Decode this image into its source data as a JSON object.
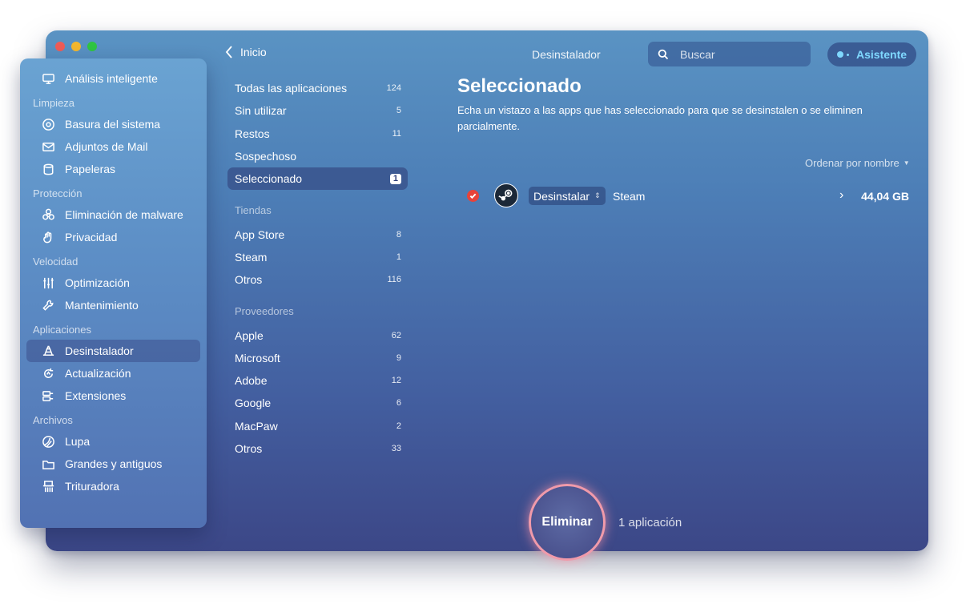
{
  "window": {
    "title": "Desinstalador",
    "back_label": "Inicio",
    "search_placeholder": "Buscar",
    "assistant_label": "Asistente"
  },
  "sidebar": {
    "top": {
      "label": "Análisis inteligente",
      "icon": "monitor-icon"
    },
    "sections": [
      {
        "title": "Limpieza",
        "items": [
          {
            "label": "Basura del sistema",
            "icon": "disc-icon"
          },
          {
            "label": "Adjuntos de Mail",
            "icon": "envelope-icon"
          },
          {
            "label": "Papeleras",
            "icon": "trash-icon"
          }
        ]
      },
      {
        "title": "Protección",
        "items": [
          {
            "label": "Eliminación de malware",
            "icon": "biohazard-icon"
          },
          {
            "label": "Privacidad",
            "icon": "hand-icon"
          }
        ]
      },
      {
        "title": "Velocidad",
        "items": [
          {
            "label": "Optimización",
            "icon": "sliders-icon"
          },
          {
            "label": "Mantenimiento",
            "icon": "wrench-icon"
          }
        ]
      },
      {
        "title": "Aplicaciones",
        "items": [
          {
            "label": "Desinstalador",
            "icon": "uninstaller-icon",
            "active": true
          },
          {
            "label": "Actualización",
            "icon": "updater-icon"
          },
          {
            "label": "Extensiones",
            "icon": "extensions-icon"
          }
        ]
      },
      {
        "title": "Archivos",
        "items": [
          {
            "label": "Lupa",
            "icon": "lens-icon"
          },
          {
            "label": "Grandes y antiguos",
            "icon": "folder-icon"
          },
          {
            "label": "Trituradora",
            "icon": "shredder-icon"
          }
        ]
      }
    ]
  },
  "filters": {
    "all": [
      {
        "label": "Todas las aplicaciones",
        "count": "124"
      },
      {
        "label": "Sin utilizar",
        "count": "5"
      },
      {
        "label": "Restos",
        "count": "11"
      },
      {
        "label": "Sospechoso",
        "count": ""
      },
      {
        "label": "Seleccionado",
        "count": "1",
        "active": true
      }
    ],
    "stores_title": "Tiendas",
    "stores": [
      {
        "label": "App Store",
        "count": "8"
      },
      {
        "label": "Steam",
        "count": "1"
      },
      {
        "label": "Otros",
        "count": "116"
      }
    ],
    "vendors_title": "Proveedores",
    "vendors": [
      {
        "label": "Apple",
        "count": "62"
      },
      {
        "label": "Microsoft",
        "count": "9"
      },
      {
        "label": "Adobe",
        "count": "12"
      },
      {
        "label": "Google",
        "count": "6"
      },
      {
        "label": "MacPaw",
        "count": "2"
      },
      {
        "label": "Otros",
        "count": "33"
      }
    ]
  },
  "main": {
    "heading": "Seleccionado",
    "description": "Echa un vistazo a las apps que has seleccionado para que se desinstalen o se eliminen parcialmente.",
    "sort_label": "Ordenar por nombre",
    "app": {
      "action": "Desinstalar",
      "name": "Steam",
      "size": "44,04 GB",
      "checked": true
    },
    "remove_button": "Eliminar",
    "remove_info": "1 aplicación"
  },
  "colors": {
    "accent_cyan": "#7fd8ff",
    "check_red": "#e8433a",
    "button_ring": "#f09aaa"
  }
}
